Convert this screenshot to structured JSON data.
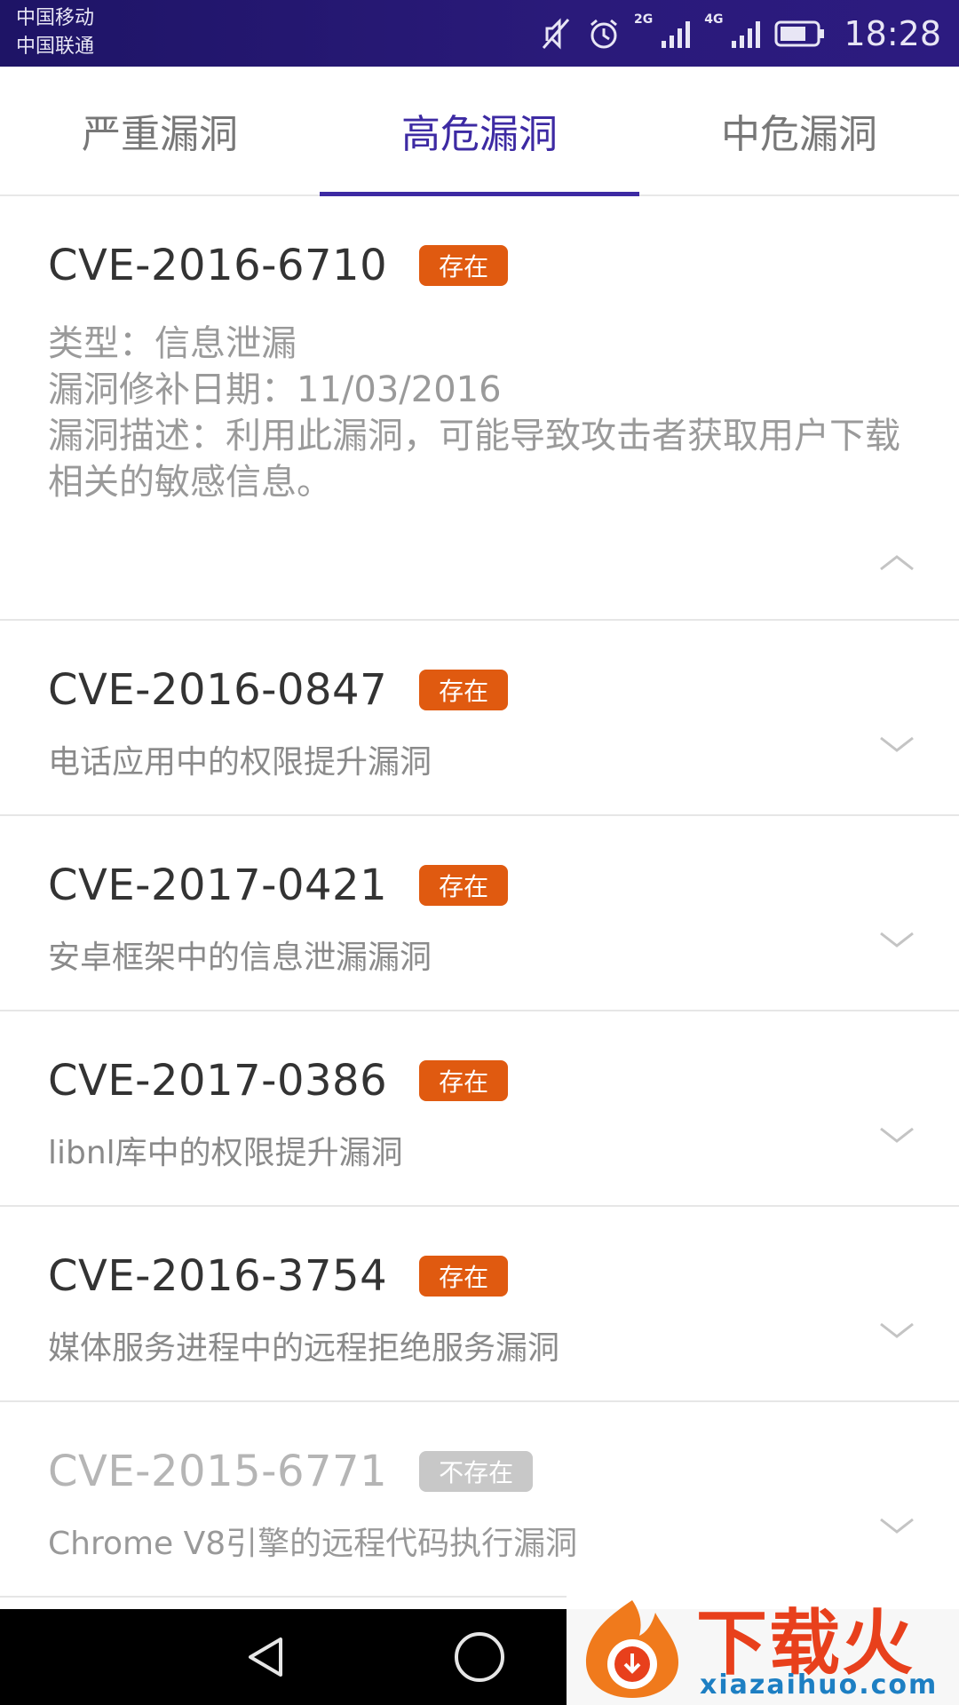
{
  "status_bar": {
    "carrier1": "中国移动",
    "carrier2": "中国联通",
    "net1": "2G",
    "net2": "4G",
    "time": "18:28"
  },
  "tabs": [
    {
      "label": "严重漏洞",
      "active": false
    },
    {
      "label": "高危漏洞",
      "active": true
    },
    {
      "label": "中危漏洞",
      "active": false
    }
  ],
  "items": [
    {
      "id": "CVE-2016-6710",
      "badge": "存在",
      "expanded": true,
      "type_line": "类型：信息泄漏",
      "date_line": "漏洞修补日期：11/03/2016",
      "desc_line": "漏洞描述：利用此漏洞，可能导致攻击者获取用户下载相关的敏感信息。"
    },
    {
      "id": "CVE-2016-0847",
      "badge": "存在",
      "summary": "电话应用中的权限提升漏洞"
    },
    {
      "id": "CVE-2017-0421",
      "badge": "存在",
      "summary": "安卓框架中的信息泄漏漏洞"
    },
    {
      "id": "CVE-2017-0386",
      "badge": "存在",
      "summary": "libnl库中的权限提升漏洞"
    },
    {
      "id": "CVE-2016-3754",
      "badge": "存在",
      "summary": "媒体服务进程中的远程拒绝服务漏洞"
    },
    {
      "id": "CVE-2015-6771",
      "badge": "不存在",
      "summary": "Chrome V8引擎的远程代码执行漏洞"
    }
  ],
  "watermark": {
    "text": "下载火",
    "domain": "xiazaihuo.com"
  },
  "colors": {
    "accent": "#3d2aa3",
    "badge_present": "#e05a10",
    "badge_absent": "#c8c8c8"
  }
}
